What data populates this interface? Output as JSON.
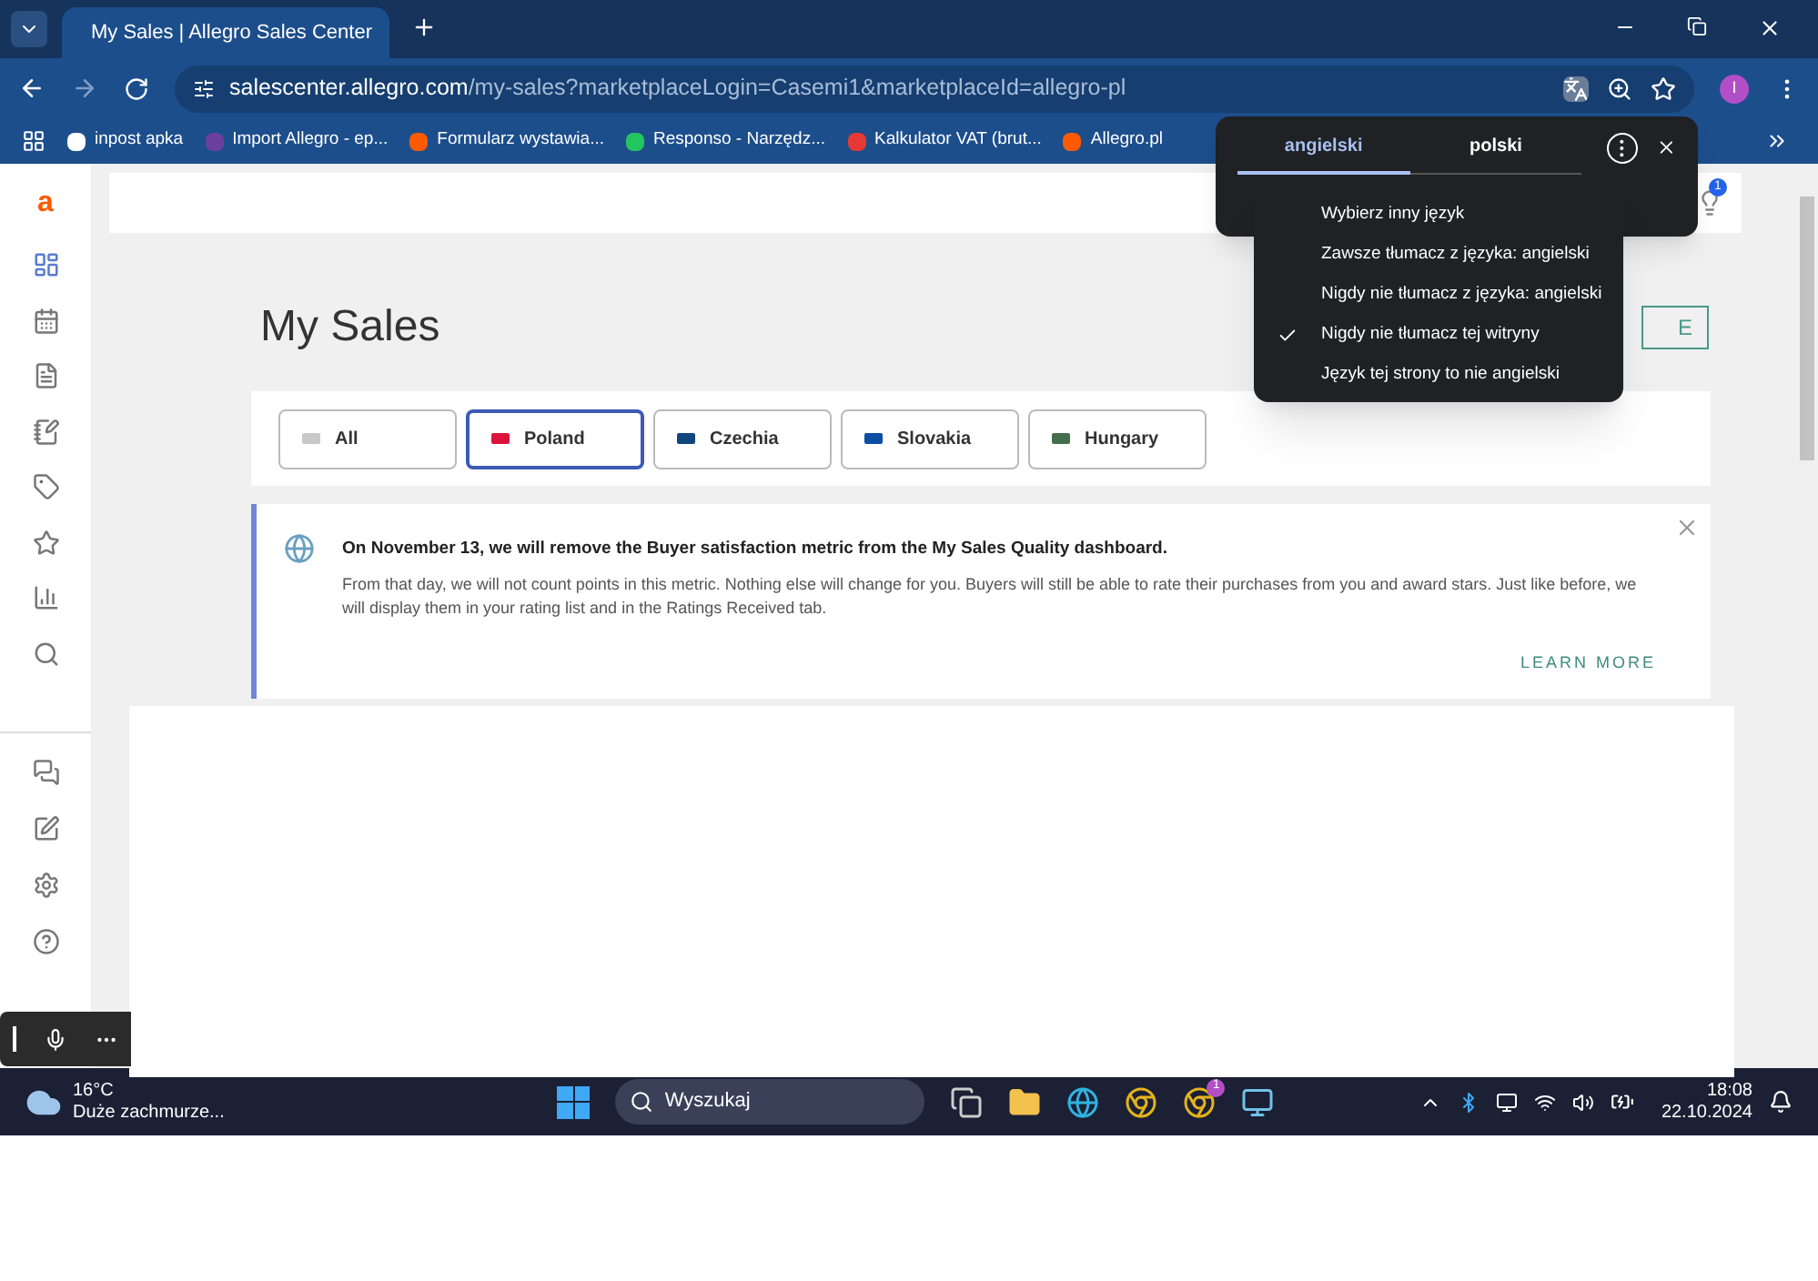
{
  "browser": {
    "tab_title": "My Sales | Allegro Sales Center",
    "url_host": "salescenter.allegro.com",
    "url_path": "/my-sales?marketplaceLogin=Casemi1&marketplaceId=allegro-pl",
    "profile_initial": "I",
    "bookmarks": [
      {
        "label": "inpost apka",
        "color": "#ffffff"
      },
      {
        "label": "Import Allegro - ep...",
        "color": "#6b3fa0"
      },
      {
        "label": "Formularz wystawia...",
        "color": "#ff5a00"
      },
      {
        "label": "Responso - Narzędz...",
        "color": "#22c55e"
      },
      {
        "label": "Kalkulator VAT (brut...",
        "color": "#e53935"
      },
      {
        "label": "Allegro.pl",
        "color": "#ff5a00"
      }
    ]
  },
  "page": {
    "logo": "a",
    "notification_count": "1",
    "title": "My Sales",
    "header_button": "E",
    "countries": [
      {
        "label": "All",
        "selected": false,
        "color": "#c8c8c8"
      },
      {
        "label": "Poland",
        "selected": true,
        "color": "#dc143c"
      },
      {
        "label": "Czechia",
        "selected": false,
        "color": "#11457e"
      },
      {
        "label": "Slovakia",
        "selected": false,
        "color": "#0b4ea2"
      },
      {
        "label": "Hungary",
        "selected": false,
        "color": "#436f4d"
      }
    ],
    "notice": {
      "heading": "On November 13, we will remove the Buyer satisfaction metric from the My Sales Quality dashboard.",
      "body": "From that day, we will not count points in this metric. Nothing else will change for you. Buyers will still be able to rate their purchases from you and award stars. Just like before, we will display them in your rating list and in the Ratings Received tab.",
      "link": "LEARN MORE"
    }
  },
  "translate_popup": {
    "tabs": [
      {
        "label": "angielski",
        "selected": true
      },
      {
        "label": "polski",
        "selected": false
      }
    ],
    "menu": [
      {
        "label": "Wybierz inny język",
        "checked": false
      },
      {
        "label": "Zawsze tłumacz z języka: angielski",
        "checked": false
      },
      {
        "label": "Nigdy nie tłumacz z języka: angielski",
        "checked": false
      },
      {
        "label": "Nigdy nie tłumacz tej witryny",
        "checked": true
      },
      {
        "label": "Język tej strony to nie angielski",
        "checked": false
      }
    ]
  },
  "taskbar": {
    "temperature": "16°C",
    "weather": "Duże zachmurze...",
    "search_placeholder": "Wyszukaj",
    "chrome_badge": "1",
    "time": "18:08",
    "date": "22.10.2024"
  }
}
